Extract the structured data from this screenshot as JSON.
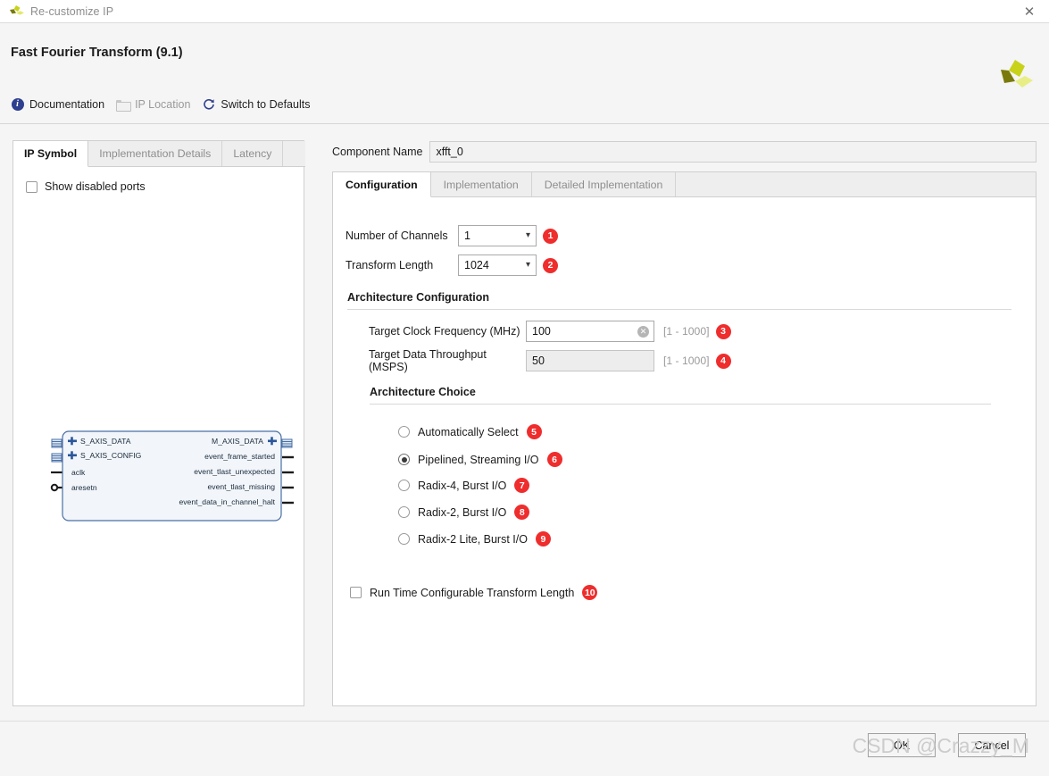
{
  "window": {
    "title": "Re-customize IP",
    "close_label": "✕",
    "logo_name": "xilinx-logo"
  },
  "header": {
    "title": "Fast Fourier Transform (9.1)",
    "toolbar": [
      {
        "label": "Documentation",
        "icon": "info-icon",
        "enabled": true
      },
      {
        "label": "IP Location",
        "icon": "folder-icon",
        "enabled": false
      },
      {
        "label": "Switch to Defaults",
        "icon": "refresh-icon",
        "enabled": true
      }
    ]
  },
  "left_panel": {
    "tabs": [
      {
        "label": "IP Symbol",
        "active": true
      },
      {
        "label": "Implementation Details",
        "active": false
      },
      {
        "label": "Latency",
        "active": false
      }
    ],
    "show_disabled_ports": {
      "label": "Show disabled ports",
      "checked": false
    },
    "symbol": {
      "left_ports": [
        {
          "name": "S_AXIS_DATA",
          "type": "bus"
        },
        {
          "name": "S_AXIS_CONFIG",
          "type": "bus"
        },
        {
          "name": "aclk",
          "type": "clock"
        },
        {
          "name": "aresetn",
          "type": "reset"
        }
      ],
      "right_ports": [
        {
          "name": "M_AXIS_DATA",
          "type": "bus"
        },
        {
          "name": "event_frame_started",
          "type": "signal"
        },
        {
          "name": "event_tlast_unexpected",
          "type": "signal"
        },
        {
          "name": "event_tlast_missing",
          "type": "signal"
        },
        {
          "name": "event_data_in_channel_halt",
          "type": "signal"
        }
      ]
    }
  },
  "right_panel": {
    "component_name": {
      "label": "Component Name",
      "value": "xfft_0"
    },
    "tabs": [
      {
        "label": "Configuration",
        "active": true
      },
      {
        "label": "Implementation",
        "active": false
      },
      {
        "label": "Detailed Implementation",
        "active": false
      }
    ],
    "fields": {
      "number_of_channels": {
        "label": "Number of Channels",
        "value": "1",
        "badge": "1"
      },
      "transform_length": {
        "label": "Transform Length",
        "value": "1024",
        "badge": "2"
      }
    },
    "architecture_configuration": {
      "title": "Architecture Configuration",
      "target_clock_frequency": {
        "label": "Target Clock Frequency (MHz)",
        "value": "100",
        "range": "[1 - 1000]",
        "badge": "3",
        "readonly": false
      },
      "target_data_throughput": {
        "label": "Target Data Throughput (MSPS)",
        "value": "50",
        "range": "[1 - 1000]",
        "badge": "4",
        "readonly": true
      }
    },
    "architecture_choice": {
      "title": "Architecture Choice",
      "options": [
        {
          "label": "Automatically Select",
          "badge": "5",
          "selected": false
        },
        {
          "label": "Pipelined, Streaming I/O",
          "badge": "6",
          "selected": true
        },
        {
          "label": "Radix-4, Burst I/O",
          "badge": "7",
          "selected": false
        },
        {
          "label": "Radix-2, Burst I/O",
          "badge": "8",
          "selected": false
        },
        {
          "label": "Radix-2 Lite, Burst I/O",
          "badge": "9",
          "selected": false
        }
      ]
    },
    "run_time_configurable": {
      "label": "Run Time Configurable Transform Length",
      "badge": "10",
      "checked": false
    }
  },
  "footer": {
    "ok_label": "OK",
    "cancel_label": "Cancel"
  },
  "watermark": "CSDN @Crazzy_M",
  "colors": {
    "badge_red": "#ef2d2d",
    "accent_blue": "#2f3f8f",
    "logo_green": "#c8d219",
    "logo_dark": "#7a7a0c",
    "symbol_fill": "#f2f6fb",
    "symbol_stroke": "#4a6fa5"
  }
}
